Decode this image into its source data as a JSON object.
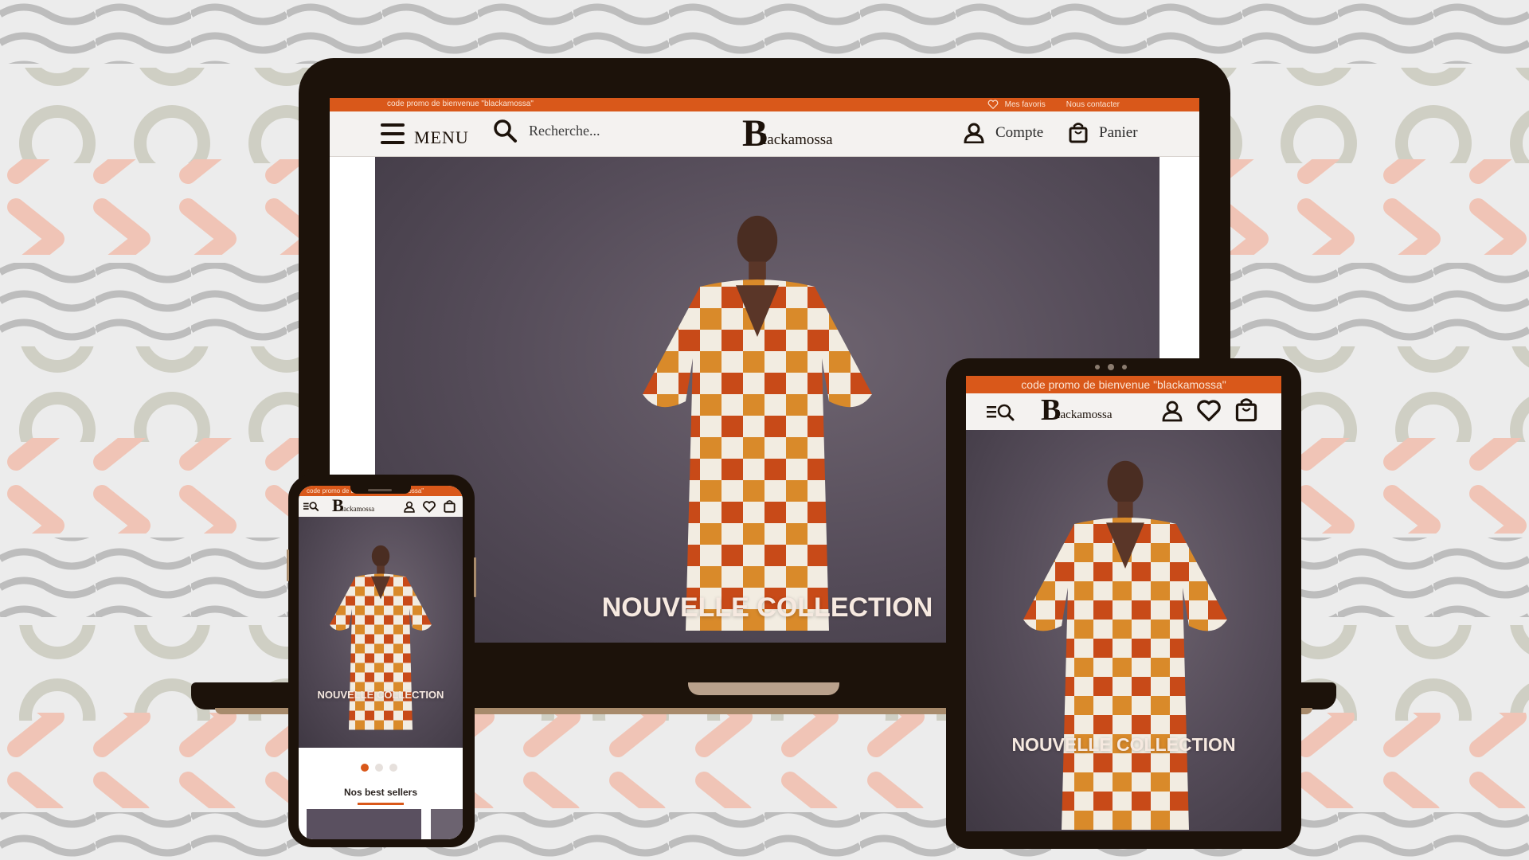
{
  "colors": {
    "accent": "#d9581a",
    "device_frame": "#1c120a",
    "nav_bg": "#f4f2f0",
    "hero_text": "#f6e9e0"
  },
  "desktop": {
    "promo_text": "code promo  de bienvenue \"blackamossa\"",
    "favorites_label": "Mes favoris",
    "contact_label": "Nous contacter",
    "menu_label": "MENU",
    "search_placeholder": "Recherche...",
    "brand_initial": "B",
    "brand_rest": "lackamossa",
    "account_label": "Compte",
    "cart_label": "Panier",
    "hero_title": "NOUVELLE COLLECTION"
  },
  "tablet": {
    "promo_text": "code promo  de bienvenue \"blackamossa\"",
    "brand_initial": "B",
    "brand_rest": "lackamossa",
    "hero_title": "NOUVELLE COLLECTION"
  },
  "phone": {
    "promo_text": "code promo  de bienvenue \"blackamossa\"",
    "brand_initial": "B",
    "brand_rest": "lackamossa",
    "hero_title": "NOUVELLE COLLECTION",
    "best_sellers_title": "Nos best sellers",
    "carousel_active_index": 0,
    "carousel_count": 3
  },
  "icons": [
    "hamburger-menu-icon",
    "search-icon",
    "user-icon",
    "shopping-bag-icon",
    "heart-icon",
    "menu-search-combo-icon"
  ]
}
